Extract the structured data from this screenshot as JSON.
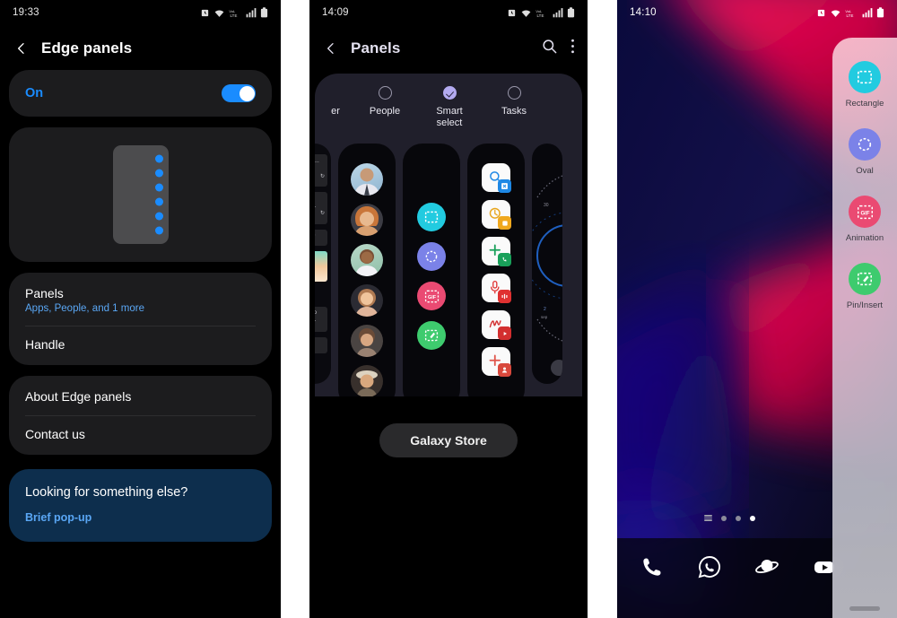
{
  "colors": {
    "accent_blue": "#1a8cff",
    "link_blue": "#5aa7f5",
    "promo_bg": "#0d2e4d",
    "card_bg": "#1c1c1e",
    "checked_purple": "#b3aaf0",
    "cyan": "#22cbe0",
    "periwinkle": "#7b82e8",
    "pink": "#ea4a72",
    "green": "#3ecb6e"
  },
  "screen1": {
    "statusbar": {
      "time": "19:33",
      "icons": [
        "alarm-icon",
        "wifi-icon",
        "lte-icon",
        "signal-icon",
        "battery-icon"
      ]
    },
    "header": {
      "back": "back-icon",
      "title": "Edge panels"
    },
    "toggle": {
      "label": "On",
      "state": "on"
    },
    "preview": {
      "name": "edge-handle-preview",
      "dot_count": 6
    },
    "settings_list": [
      {
        "title": "Panels",
        "subtitle": "Apps, People, and 1 more"
      },
      {
        "title": "Handle",
        "subtitle": ""
      }
    ],
    "info_list": [
      {
        "title": "About Edge panels"
      },
      {
        "title": "Contact us"
      }
    ],
    "promo": {
      "title": "Looking for something else?",
      "link": "Brief pop-up"
    }
  },
  "screen2": {
    "statusbar": {
      "time": "14:09",
      "icons": [
        "alarm-icon",
        "wifi-icon",
        "lte-icon",
        "signal-icon",
        "battery-icon"
      ]
    },
    "header": {
      "back": "back-icon",
      "title": "Panels",
      "search": "search-icon",
      "more": "more-vert-icon"
    },
    "panels": [
      {
        "label": "er",
        "checked": false,
        "type": "clipboard",
        "partial": true
      },
      {
        "label": "People",
        "checked": false,
        "type": "people"
      },
      {
        "label": "Smart select",
        "checked": true,
        "type": "smart-select"
      },
      {
        "label": "Tasks",
        "checked": false,
        "type": "tasks"
      },
      {
        "label": "",
        "checked": false,
        "type": "weather",
        "partial": true
      }
    ],
    "smart_select_icons": [
      "rectangle-icon",
      "oval-icon",
      "gif-animation-icon",
      "pin-insert-icon"
    ],
    "store_button": "Galaxy Store"
  },
  "screen3": {
    "statusbar": {
      "time": "14:10",
      "icons": [
        "alarm-icon",
        "wifi-icon",
        "lte-icon",
        "signal-icon",
        "battery-icon"
      ]
    },
    "edge_panel": {
      "items": [
        {
          "label": "Rectangle",
          "icon": "rectangle-icon",
          "color": "#22cbe0"
        },
        {
          "label": "Oval",
          "icon": "oval-icon",
          "color": "#7b82e8"
        },
        {
          "label": "Animation",
          "icon": "gif-animation-icon",
          "color": "#ea4a72"
        },
        {
          "label": "Pin/Insert",
          "icon": "pin-insert-icon",
          "color": "#3ecb6e"
        }
      ]
    },
    "page_dots": {
      "count": 3,
      "active_index": 2
    },
    "dock": [
      {
        "name": "phone-icon"
      },
      {
        "name": "whatsapp-icon"
      },
      {
        "name": "browser-icon"
      },
      {
        "name": "youtube-icon"
      }
    ]
  }
}
